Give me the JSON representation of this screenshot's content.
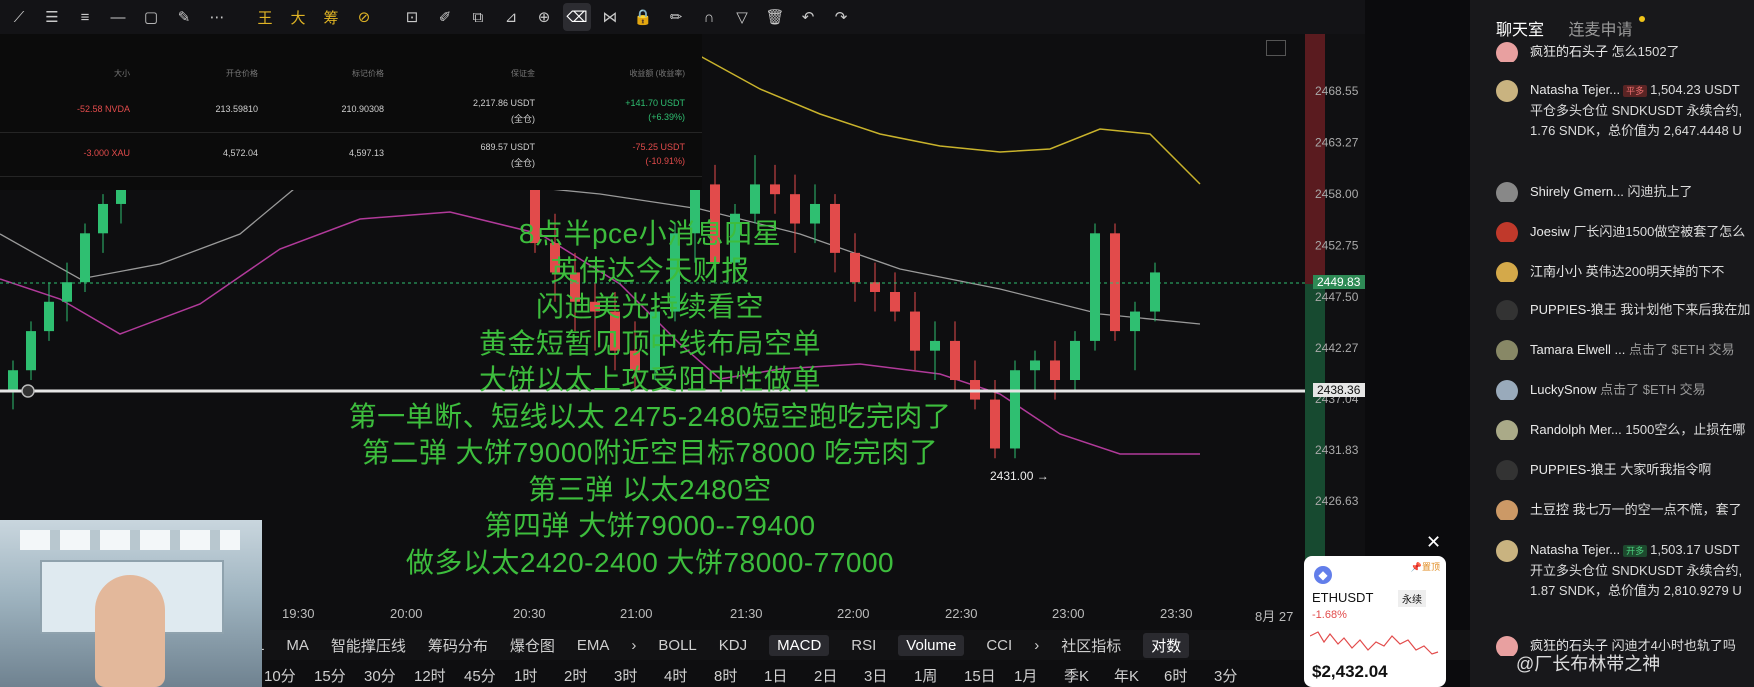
{
  "toolbar": {
    "tools": [
      "line-icon",
      "menu-icon",
      "hlines-icon",
      "hline-icon",
      "rect-icon",
      "brush-icon",
      "more-icon",
      "wang-icon",
      "da-icon",
      "chou-icon",
      "ruler-icon",
      "shape-icon",
      "magic-icon",
      "dup-icon",
      "measure-icon",
      "zoom-icon",
      "eraser-icon",
      "mirror-icon",
      "lock-icon",
      "edit-icon",
      "magnet-icon",
      "filter-icon",
      "trash-icon",
      "undo-icon",
      "redo-icon"
    ]
  },
  "positions": {
    "headers": [
      "大小",
      "开仓价格",
      "标记价格",
      "保证金",
      "收益额 (收益率)"
    ],
    "rows": [
      {
        "size": "-52.58 NVDA",
        "entry": "213.59810",
        "mark": "210.90308",
        "margin": "2,217.86 USDT",
        "margin_mode": "(全仓)",
        "pnl": "+141.70 USDT",
        "pnl_pct": "(+6.39%)"
      },
      {
        "size": "-3.000 XAU",
        "entry": "4,572.04",
        "mark": "4,597.13",
        "margin": "689.57 USDT",
        "margin_mode": "(全仓)",
        "pnl": "-75.25 USDT",
        "pnl_pct": "(-10.91%)"
      }
    ]
  },
  "overlay_lines": [
    "8点半pce小消息四星",
    "英伟达今天财报",
    "闪迪美光持续看空",
    "黄金短暂见顶中线布局空单",
    "大饼以太上攻受阻中性做单",
    "第一单断、短线以太 2475-2480短空跑吃完肉了",
    "第二弹 大饼79000附近空目标78000 吃完肉了",
    "第三弹 以太2480空",
    "第四弹 大饼79000--79400",
    "做多以太2420-2400 大饼78000-77000"
  ],
  "chart_data": {
    "type": "candlestick",
    "y_ticks": [
      "2468.55",
      "2463.27",
      "2458.00",
      "2452.75",
      "2447.50",
      "2442.27",
      "2437.04",
      "2431.83",
      "2426.63"
    ],
    "current_price": "2449.83",
    "hline_price": "2438.36",
    "low_marker": "2431.00",
    "x_ticks": [
      "19:30",
      "20:00",
      "20:30",
      "21:00",
      "21:30",
      "22:00",
      "22:30",
      "23:00",
      "23:30",
      "8月 27"
    ],
    "candles": [
      {
        "o": 2438,
        "h": 2441,
        "l": 2436,
        "c": 2440
      },
      {
        "o": 2440,
        "h": 2445,
        "l": 2439,
        "c": 2444
      },
      {
        "o": 2444,
        "h": 2449,
        "l": 2443,
        "c": 2447
      },
      {
        "o": 2447,
        "h": 2451,
        "l": 2445,
        "c": 2449
      },
      {
        "o": 2449,
        "h": 2455,
        "l": 2448,
        "c": 2454
      },
      {
        "o": 2454,
        "h": 2458,
        "l": 2452,
        "c": 2457
      },
      {
        "o": 2457,
        "h": 2460,
        "l": 2455,
        "c": 2459
      },
      {
        "o": 2459,
        "h": 2463,
        "l": 2452,
        "c": 2453
      },
      {
        "o": 2453,
        "h": 2456,
        "l": 2447,
        "c": 2450
      },
      {
        "o": 2450,
        "h": 2452,
        "l": 2444,
        "c": 2447
      },
      {
        "o": 2447,
        "h": 2449,
        "l": 2442,
        "c": 2446
      },
      {
        "o": 2446,
        "h": 2448,
        "l": 2440,
        "c": 2442
      },
      {
        "o": 2442,
        "h": 2445,
        "l": 2438,
        "c": 2440
      },
      {
        "o": 2440,
        "h": 2448,
        "l": 2439,
        "c": 2446
      },
      {
        "o": 2446,
        "h": 2455,
        "l": 2445,
        "c": 2454
      },
      {
        "o": 2454,
        "h": 2462,
        "l": 2451,
        "c": 2459
      },
      {
        "o": 2459,
        "h": 2461,
        "l": 2449,
        "c": 2451
      },
      {
        "o": 2451,
        "h": 2457,
        "l": 2449,
        "c": 2456
      },
      {
        "o": 2456,
        "h": 2462,
        "l": 2455,
        "c": 2459
      },
      {
        "o": 2459,
        "h": 2461,
        "l": 2456,
        "c": 2458
      },
      {
        "o": 2458,
        "h": 2460,
        "l": 2452,
        "c": 2455
      },
      {
        "o": 2455,
        "h": 2459,
        "l": 2453,
        "c": 2457
      },
      {
        "o": 2457,
        "h": 2458,
        "l": 2450,
        "c": 2452
      },
      {
        "o": 2452,
        "h": 2454,
        "l": 2447,
        "c": 2449
      },
      {
        "o": 2449,
        "h": 2451,
        "l": 2446,
        "c": 2448
      },
      {
        "o": 2448,
        "h": 2450,
        "l": 2445,
        "c": 2446
      },
      {
        "o": 2446,
        "h": 2448,
        "l": 2440,
        "c": 2442
      },
      {
        "o": 2442,
        "h": 2445,
        "l": 2439,
        "c": 2443
      },
      {
        "o": 2443,
        "h": 2445,
        "l": 2438,
        "c": 2439
      },
      {
        "o": 2439,
        "h": 2441,
        "l": 2436,
        "c": 2437
      },
      {
        "o": 2437,
        "h": 2439,
        "l": 2431,
        "c": 2432
      },
      {
        "o": 2432,
        "h": 2441,
        "l": 2431,
        "c": 2440
      },
      {
        "o": 2440,
        "h": 2442,
        "l": 2438,
        "c": 2441
      },
      {
        "o": 2441,
        "h": 2443,
        "l": 2437,
        "c": 2439
      },
      {
        "o": 2439,
        "h": 2444,
        "l": 2438,
        "c": 2443
      },
      {
        "o": 2443,
        "h": 2455,
        "l": 2442,
        "c": 2454
      },
      {
        "o": 2454,
        "h": 2455,
        "l": 2443,
        "c": 2444
      },
      {
        "o": 2444,
        "h": 2447,
        "l": 2440,
        "c": 2446
      },
      {
        "o": 2446,
        "h": 2451,
        "l": 2445,
        "c": 2450
      }
    ]
  },
  "indicator_bar": [
    "L",
    "MA",
    "智能撑压线",
    "筹码分布",
    "爆仓图",
    "EMA",
    "›",
    "BOLL",
    "KDJ",
    "MACD",
    "RSI",
    "Volume",
    "CCI",
    "›",
    "社区指标",
    "对数"
  ],
  "period_bar": [
    "10分",
    "15分",
    "30分",
    "12时",
    "45分",
    "1时",
    "2时",
    "3时",
    "4时",
    "8时",
    "1日",
    "2日",
    "3日",
    "1周",
    "15日",
    "1月",
    "季K",
    "年K",
    "6时",
    "3分"
  ],
  "eth_card": {
    "symbol": "ETHUSDT",
    "tag": "永续",
    "change": "-1.68%",
    "price": "$2,432.04",
    "pin": "置顶"
  },
  "chat": {
    "tab_active": "聊天室",
    "tab_other": "连麦申请",
    "messages": [
      {
        "user": "疯狂的石头子",
        "text": "怎么1502了"
      },
      {
        "user": "Natasha Tejer...",
        "badge": "平多",
        "text": "1,504.23 USDT",
        "line2": "平仓多头仓位 SNDKUSDT 永续合约,",
        "line3": "1.76 SNDK，总价值为 2,647.4448 U"
      },
      {
        "user": "Shirely Gmern...",
        "text": "闪迪抗上了"
      },
      {
        "user": "Joesiw",
        "text": "厂长闪迪1500做空被套了怎么"
      },
      {
        "user": "江南小小",
        "text": "英伟达200明天掉的下不"
      },
      {
        "user": "PUPPIES-狼王",
        "text": "我计划他下来后我在加"
      },
      {
        "user": "Tamara Elwell ...",
        "text": "点击了 $ETH 交易"
      },
      {
        "user": "LuckySnow",
        "text": "点击了 $ETH 交易"
      },
      {
        "user": "Randolph Mer...",
        "text": "1500空么，止损在哪"
      },
      {
        "user": "PUPPIES-狼王",
        "text": "大家听我指令啊"
      },
      {
        "user": "土豆控",
        "text": "我七万一的空一点不慌，套了"
      },
      {
        "user": "Natasha Tejer...",
        "badge": "开多",
        "text": "1,503.17 USDT",
        "line2": "开立多头仓位 SNDKUSDT 永续合约,",
        "line3": "1.87 SNDK，总价值为 2,810.9279 U"
      },
      {
        "user": "疯狂的石头子",
        "text": "闪迪才4小时也轨了吗"
      }
    ],
    "watermark": "@厂长布林带之神"
  }
}
